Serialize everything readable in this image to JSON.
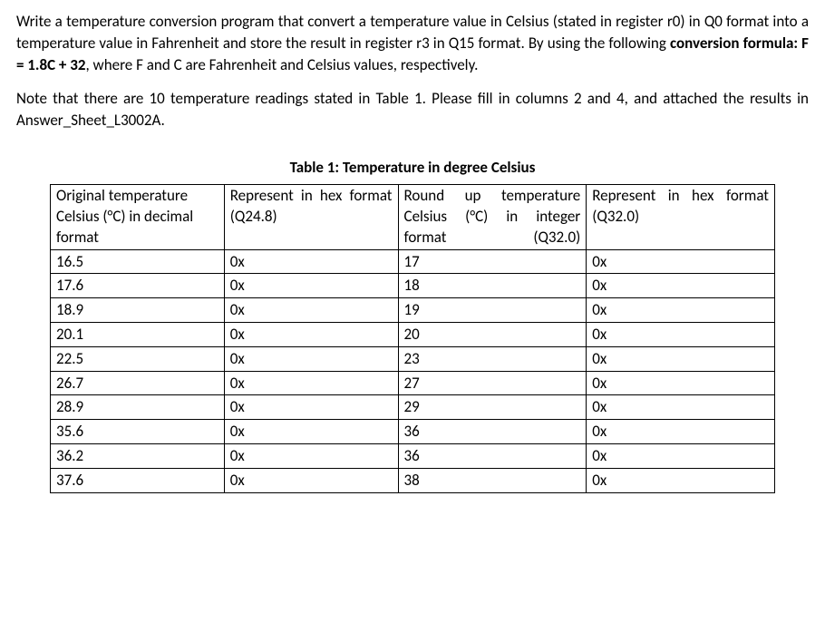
{
  "paragraphs": {
    "p1_a": "Write a temperature conversion program that convert a temperature value in Celsius (stated in register r0) in Q0 format into a temperature value in Fahrenheit and store the result in register r3 in Q15 format. By using the following ",
    "p1_b": "conversion formula: F = 1.8C + 32",
    "p1_c": ", where F and C are Fahrenheit and Celsius values, respectively.",
    "p2": "Note that there are 10 temperature readings stated in Table 1. Please fill in columns 2 and 4, and attached the results in Answer_Sheet_L3002A."
  },
  "table": {
    "title": "Table 1: Temperature in degree Celsius",
    "headers": {
      "h1": "Original temperature Celsius (°C) in decimal format",
      "h2": "Represent in hex format (Q24.8)",
      "h3": "Round up temperature Celsius (°C) in integer format (Q32.0)",
      "h4": "Represent in hex format (Q32.0)"
    },
    "rows": [
      {
        "c1": "16.5",
        "c2": "0x",
        "c3": "17",
        "c4": "0x"
      },
      {
        "c1": "17.6",
        "c2": "0x",
        "c3": "18",
        "c4": "0x"
      },
      {
        "c1": "18.9",
        "c2": "0x",
        "c3": "19",
        "c4": "0x"
      },
      {
        "c1": "20.1",
        "c2": "0x",
        "c3": "20",
        "c4": "0x"
      },
      {
        "c1": "22.5",
        "c2": "0x",
        "c3": "23",
        "c4": "0x"
      },
      {
        "c1": "26.7",
        "c2": "0x",
        "c3": "27",
        "c4": "0x"
      },
      {
        "c1": "28.9",
        "c2": "0x",
        "c3": "29",
        "c4": "0x"
      },
      {
        "c1": "35.6",
        "c2": "0x",
        "c3": "36",
        "c4": "0x"
      },
      {
        "c1": "36.2",
        "c2": "0x",
        "c3": "36",
        "c4": "0x"
      },
      {
        "c1": "37.6",
        "c2": "0x",
        "c3": "38",
        "c4": "0x"
      }
    ]
  }
}
